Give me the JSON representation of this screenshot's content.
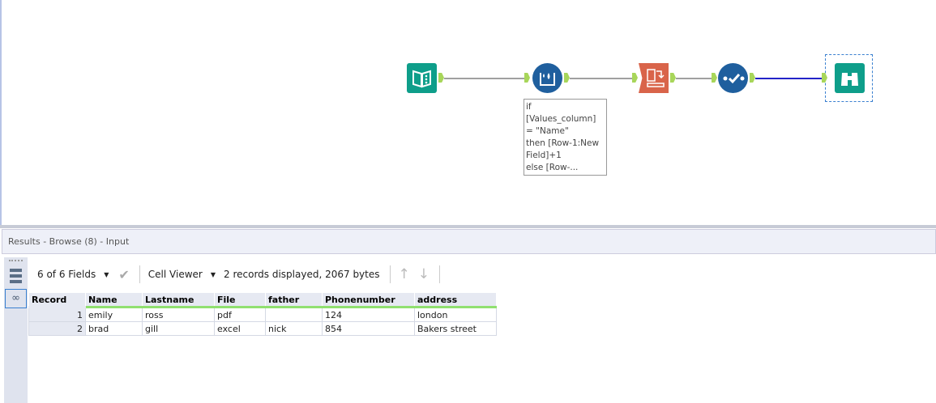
{
  "workflow": {
    "annotation": "if\n[Values_column]\n= \"Name\"\nthen [Row-1:New\nField]+1\nelse [Row-..."
  },
  "results": {
    "title": "Results - Browse (8) - Input",
    "fields_label": "6 of 6 Fields",
    "viewer_label": "Cell Viewer",
    "summary": "2 records displayed, 2067 bytes",
    "columns": [
      "Record",
      "Name",
      "Lastname",
      "File",
      "father",
      "Phonenumber",
      "address"
    ],
    "rows": [
      [
        "1",
        "emily",
        "ross",
        "pdf",
        "",
        "124",
        "london"
      ],
      [
        "2",
        "brad",
        "gill",
        "excel",
        "nick",
        "854",
        "Bakers street"
      ]
    ]
  },
  "colors": {
    "teal": "#0e9e8a",
    "blue": "#1f5f9e",
    "orange": "#d9644a",
    "anchor": "#a8d65a"
  }
}
